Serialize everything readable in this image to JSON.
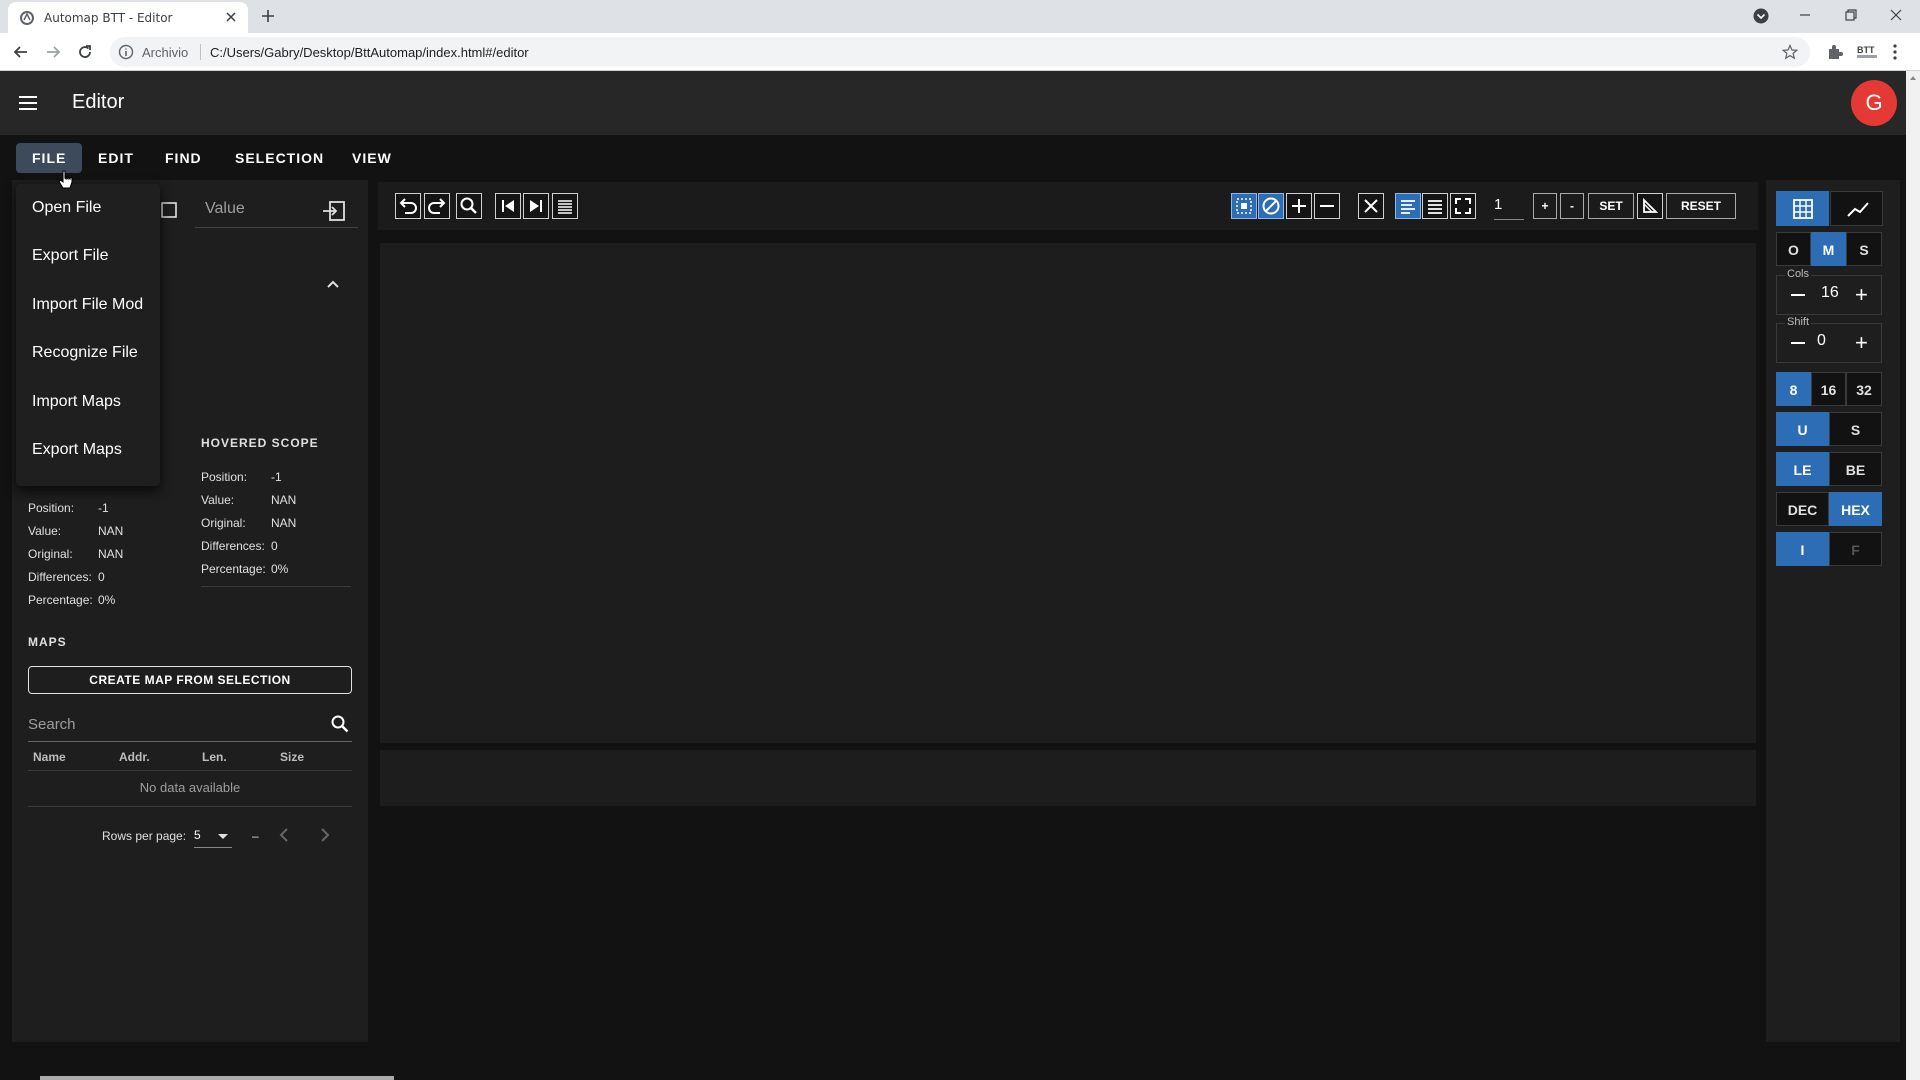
{
  "browser": {
    "tab_title": "Automap BTT - Editor",
    "scheme_label": "Archivio",
    "url": "C:/Users/Gabry/Desktop/BttAutomap/index.html#/editor"
  },
  "app": {
    "title": "Editor",
    "avatar_initial": "G",
    "accent_color": "#2d6db6",
    "avatar_color": "#e53935"
  },
  "menubar": {
    "items": [
      "FILE",
      "EDIT",
      "FIND",
      "SELECTION",
      "VIEW"
    ],
    "active": "FILE"
  },
  "file_menu": {
    "items": [
      "Open File",
      "Export File",
      "Import File Mod",
      "Recognize File",
      "Import Maps",
      "Export Maps"
    ]
  },
  "left_panel": {
    "value_placeholder": "Value",
    "hovered_scope": {
      "title": "HOVERED SCOPE",
      "position_label": "Position:",
      "position": "-1",
      "value_label": "Value:",
      "value": "NAN",
      "original_label": "Original:",
      "original": "NAN",
      "differences_label": "Differences:",
      "differences": "0",
      "percentage_label": "Percentage:",
      "percentage": "0%"
    },
    "selected_scope": {
      "position_label": "Position:",
      "position": "-1",
      "value_label": "Value:",
      "value": "NAN",
      "original_label": "Original:",
      "original": "NAN",
      "differences_label": "Differences:",
      "differences": "0",
      "percentage_label": "Percentage:",
      "percentage": "0%"
    },
    "maps": {
      "title": "MAPS",
      "create_button": "CREATE MAP FROM SELECTION",
      "search_placeholder": "Search",
      "columns": [
        "Name",
        "Addr.",
        "Len.",
        "Size"
      ],
      "empty_text": "No data available",
      "rows_per_page_label": "Rows per page:",
      "rows_per_page": "5",
      "page_range": "–"
    }
  },
  "toolbar": {
    "step_value": "1",
    "plus_label": "+",
    "minus_label": "-",
    "set_label": "SET",
    "reset_label": "RESET"
  },
  "right_panel": {
    "mode_buttons": [
      "O",
      "M",
      "S"
    ],
    "mode_selected": "M",
    "cols_label": "Cols",
    "cols_value": "16",
    "shift_label": "Shift",
    "shift_value": "0",
    "bits": [
      "8",
      "16",
      "32"
    ],
    "bits_selected": "8",
    "sign": [
      "U",
      "S"
    ],
    "sign_selected": "U",
    "endian": [
      "LE",
      "BE"
    ],
    "endian_selected": "LE",
    "base": [
      "DEC",
      "HEX"
    ],
    "base_selected": "HEX",
    "type": [
      "I",
      "F"
    ],
    "type_selected": "I"
  }
}
